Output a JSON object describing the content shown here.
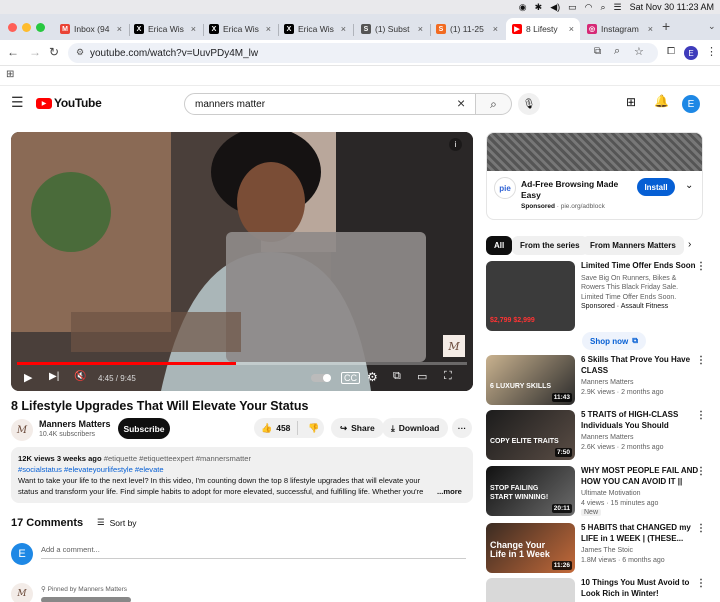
{
  "menubar": {
    "datetime": "Sat Nov 30  11:23 AM"
  },
  "tabs": [
    {
      "label": "Inbox (94",
      "color": "#ea4335",
      "glyph": "M"
    },
    {
      "label": "Erica Wis",
      "color": "#000000",
      "glyph": "X"
    },
    {
      "label": "Erica Wis",
      "color": "#000000",
      "glyph": "X"
    },
    {
      "label": "Erica Wis",
      "color": "#000000",
      "glyph": "X"
    },
    {
      "label": "(1) Subst",
      "color": "#555555",
      "glyph": "S"
    },
    {
      "label": "(1) 11-25",
      "color": "#f26b21",
      "glyph": "S"
    },
    {
      "label": "8 Lifesty",
      "color": "#ff0000",
      "glyph": "▶"
    },
    {
      "label": "Instagram",
      "color": "#d62976",
      "glyph": "◎"
    }
  ],
  "address": {
    "url": "youtube.com/watch?v=UuvPDy4M_lw"
  },
  "profile_initial": "E",
  "youtube": {
    "logo_text": "YouTube",
    "search_value": "manners matter",
    "avatar_initial": "E"
  },
  "video": {
    "time": "4:45 / 9:45",
    "progress": 0.487,
    "watermark": "M",
    "title": "8 Lifestyle Upgrades That Will Elevate Your Status"
  },
  "channel": {
    "name": "Manners Matters",
    "subscribers": "10.4K subscribers",
    "subscribe_label": "Subscribe",
    "likes": "458",
    "share_label": "Share",
    "download_label": "Download"
  },
  "description": {
    "meta": "12K views  3 weeks ago",
    "meta_tags": "#etiquette #etiquetteexpert #mannersmatter",
    "tags": "#socialstatus  #elevateyourlifestyle  #elevate",
    "text": "Want to take your life to the next level? In this video, I'm counting down the top 8 lifestyle upgrades that will elevate your status and transform your life. Find simple habits to adopt for more elevated, successful, and fulfilling life. Whether you're looking to boo",
    "more": "...more"
  },
  "comments": {
    "count_label": "17 Comments",
    "sort_label": "Sort by",
    "add_placeholder": "Add a comment...",
    "pinned_label": "Pinned by Manners Matters",
    "commenter_initial": "E"
  },
  "ad": {
    "logo": "pie",
    "title": "Ad-Free Browsing Made Easy",
    "sponsored": "Sponsored",
    "domain": "pie.org/adblock",
    "install_label": "Install"
  },
  "chips": [
    "All",
    "From the series",
    "From Manners Matters"
  ],
  "recommendations": [
    {
      "title": "Limited Time Offer Ends Soon",
      "line1": "Save Big On Runners, Bikes & Rowers This Black Friday Sale. Limited Time Offer Ends Soon.",
      "line2": "Sponsored · Assault Fitness",
      "thumb_text": "$2,799 $2,999",
      "shop_label": "Shop now"
    },
    {
      "title": "6 Skills That Prove You Have CLASS",
      "line1": "Manners Matters",
      "line2": "2.9K views  · 2 months ago",
      "thumb_text": "6 LUXURY SKILLS",
      "duration": "11:43"
    },
    {
      "title": "5 TRAITS of HIGH-CLASS Individuals You Should COPY...",
      "line1": "Manners Matters",
      "line2": "2.6K views  · 2 months ago",
      "thumb_text": "COPY ELITE TRAITS",
      "duration": "7:50"
    },
    {
      "title": "WHY MOST PEOPLE FAIL AND HOW YOU CAN AVOID IT || JIM...",
      "line1": "Ultimate Motivation",
      "line2": "4 views  · 15 minutes ago",
      "line3": "New",
      "thumb_text": "STOP FAILING START WINNING!",
      "duration": "20:11"
    },
    {
      "title": "5 HABITS that CHANGED my LIFE in 1 WEEK | (THESE...",
      "line1": "James The Stoic",
      "line2": "1.8M views  · 6 months ago",
      "thumb_text": "Change Your Life in 1 Week",
      "duration": "11:26"
    },
    {
      "title": "10 Things You Must Avoid to Look Rich in Winter!",
      "line1": "",
      "line2": ""
    }
  ]
}
